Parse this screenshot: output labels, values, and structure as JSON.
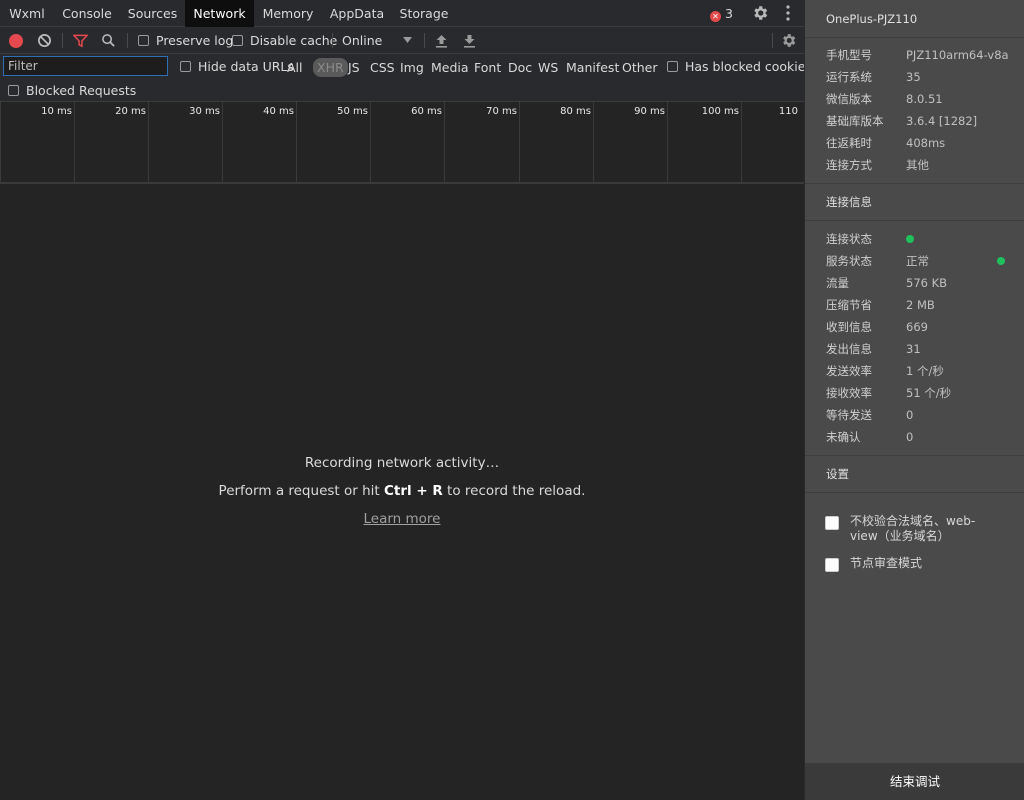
{
  "tabs": [
    {
      "label": "Wxml"
    },
    {
      "label": "Console"
    },
    {
      "label": "Sources"
    },
    {
      "label": "Network"
    },
    {
      "label": "Memory"
    },
    {
      "label": "AppData"
    },
    {
      "label": "Storage"
    }
  ],
  "active_tab": "Network",
  "error_count": "3",
  "toolbar": {
    "preserve_log": "Preserve log",
    "disable_cache": "Disable cache",
    "throttling": "Online"
  },
  "filter": {
    "placeholder": "Filter",
    "hide_data_urls": "Hide data URLs",
    "types": [
      "All",
      "XHR",
      "JS",
      "CSS",
      "Img",
      "Media",
      "Font",
      "Doc",
      "WS",
      "Manifest",
      "Other"
    ],
    "selected_type": "XHR",
    "has_blocked_cookies": "Has blocked cookies",
    "blocked_requests": "Blocked Requests"
  },
  "timeline_ticks": [
    "10 ms",
    "20 ms",
    "30 ms",
    "40 ms",
    "50 ms",
    "60 ms",
    "70 ms",
    "80 ms",
    "90 ms",
    "100 ms",
    "110"
  ],
  "empty_state": {
    "line1": "Recording network activity…",
    "line2_pre": "Perform a request or hit ",
    "shortcut": "Ctrl + R",
    "line2_post": " to record the reload.",
    "learn_more": "Learn more"
  },
  "side": {
    "title": "OnePlus-PJZ110",
    "device_info": [
      {
        "key": "手机型号",
        "value": "PJZ110arm64-v8a"
      },
      {
        "key": "运行系统",
        "value": "35"
      },
      {
        "key": "微信版本",
        "value": "8.0.51"
      },
      {
        "key": "基础库版本",
        "value": "3.6.4 [1282]"
      },
      {
        "key": "往返耗时",
        "value": "408ms"
      },
      {
        "key": "连接方式",
        "value": "其他"
      }
    ],
    "connection_title": "连接信息",
    "connection_info": [
      {
        "key": "连接状态",
        "value": ""
      },
      {
        "key": "服务状态",
        "value": "正常"
      },
      {
        "key": "流量",
        "value": "576 KB"
      },
      {
        "key": "压缩节省",
        "value": "2 MB"
      },
      {
        "key": "收到信息",
        "value": "669"
      },
      {
        "key": "发出信息",
        "value": "31"
      },
      {
        "key": "发送效率",
        "value": "1 个/秒"
      },
      {
        "key": "接收效率",
        "value": "51 个/秒"
      },
      {
        "key": "等待发送",
        "value": "0"
      },
      {
        "key": "未确认",
        "value": "0"
      }
    ],
    "settings_title": "设置",
    "settings": [
      {
        "label": "不校验合法域名、web-view（业务域名）"
      },
      {
        "label": "节点审查模式"
      }
    ],
    "end_button": "结束调试"
  },
  "colors": {
    "record_red": "#e5484d",
    "status_green": "#20c05c",
    "filter_funnel": "#e5484d"
  }
}
